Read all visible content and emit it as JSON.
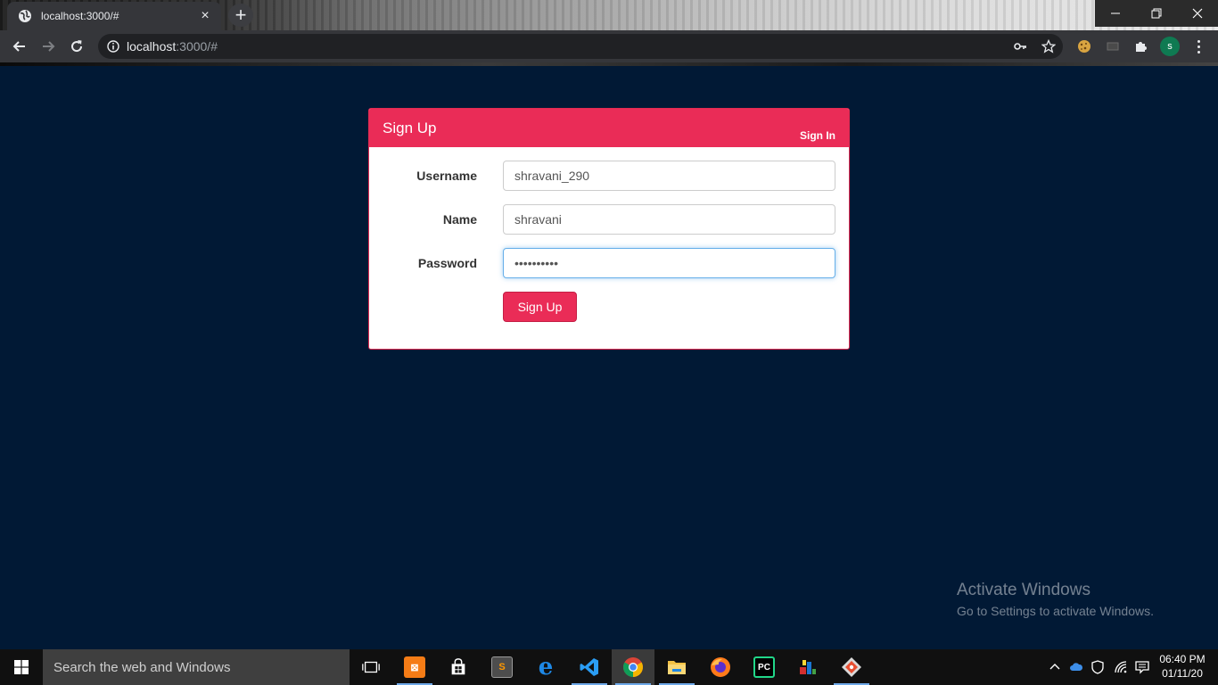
{
  "browser": {
    "tab_title": "localhost:3000/#",
    "new_tab": "+",
    "tab_close": "×",
    "url_host": "localhost",
    "url_rest": ":3000/#",
    "profile_initial": "s"
  },
  "form": {
    "title": "Sign Up",
    "signin_link": "Sign In",
    "fields": [
      {
        "label": "Username",
        "value": "shravani_290"
      },
      {
        "label": "Name",
        "value": "shravani"
      },
      {
        "label": "Password",
        "value": "shravani12"
      }
    ],
    "submit_label": "Sign Up"
  },
  "watermark": {
    "title": "Activate Windows",
    "subtitle": "Go to Settings to activate Windows."
  },
  "taskbar": {
    "search_placeholder": "Search the web and Windows",
    "time": "06:40 PM",
    "date": "01/11/20"
  },
  "colors": {
    "page_bg": "#011935",
    "accent": "#ea2c57",
    "focus": "#66afe9"
  }
}
